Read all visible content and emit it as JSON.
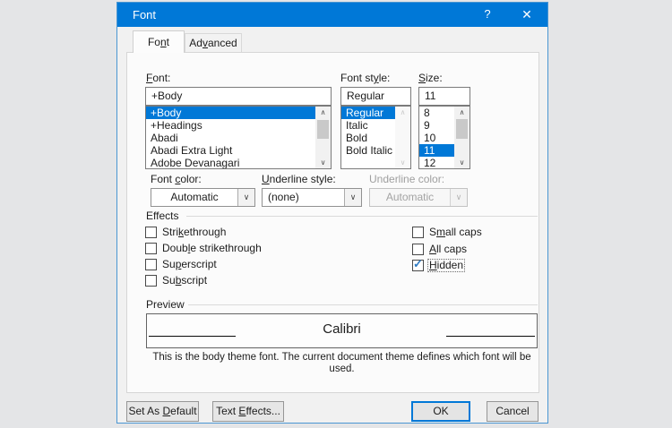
{
  "window": {
    "title": "Font",
    "help_icon": "?",
    "close_icon": "✕"
  },
  "tabs": {
    "font": "Fo&nt",
    "advanced": "Ad&vanced"
  },
  "font_picker": {
    "label": "&Font:",
    "value": "+Body",
    "items": [
      "+Body",
      "+Headings",
      "Abadi",
      "Abadi Extra Light",
      "Adobe Devanagari"
    ],
    "selected_index": 0
  },
  "style_picker": {
    "label": "Font st&yle:",
    "value": "Regular",
    "items": [
      "Regular",
      "Italic",
      "Bold",
      "Bold Italic"
    ],
    "selected_index": 0
  },
  "size_picker": {
    "label": "&Size:",
    "value": "11",
    "items": [
      "8",
      "9",
      "10",
      "11",
      "12"
    ],
    "selected_index": 3
  },
  "color_row": {
    "font_color_label": "Font &color:",
    "font_color_value": "Automatic",
    "underline_style_label": "&Underline style:",
    "underline_style_value": "(none)",
    "underline_color_label": "Underline color:",
    "underline_color_value": "Automatic"
  },
  "effects": {
    "label": "Effects",
    "checkboxes_left": [
      "Stri&kethrough",
      "Doub&le strikethrough",
      "Su&perscript",
      "Su&bscript"
    ],
    "checkboxes_right": [
      "S&mall caps",
      "&All caps",
      "&Hidden"
    ],
    "checked": [
      "Hidden"
    ]
  },
  "preview": {
    "label": "Preview",
    "sample": "Calibri",
    "description": "This is the body theme font. The current document theme defines which font will be used."
  },
  "buttons": {
    "set_default": "Set As &Default",
    "text_effects": "Text &Effects...",
    "ok": "OK",
    "cancel": "Cancel"
  },
  "icons": {
    "chevron_down": "∨",
    "scroll_up": "∧",
    "scroll_down": "∨",
    "check": "✓"
  },
  "colors": {
    "accent": "#0078d7",
    "selection": "#0078d7",
    "dialog_border": "#4a96d2"
  }
}
